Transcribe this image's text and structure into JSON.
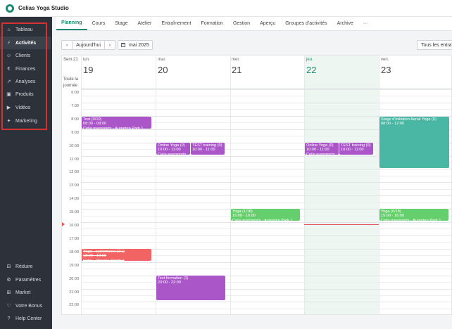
{
  "app": {
    "title": "Celias Yoga Studio"
  },
  "sidebar": {
    "items": [
      {
        "label": "Tableau",
        "icon": "home-icon"
      },
      {
        "label": "Activités",
        "icon": "activity-icon"
      },
      {
        "label": "Clients",
        "icon": "user-icon"
      },
      {
        "label": "Finances",
        "icon": "euro-icon"
      },
      {
        "label": "Analyses",
        "icon": "chart-icon"
      },
      {
        "label": "Produits",
        "icon": "box-icon"
      },
      {
        "label": "Vidéos",
        "icon": "play-icon"
      },
      {
        "label": "Marketing",
        "icon": "megaphone-icon"
      }
    ],
    "bottom": [
      {
        "label": "Réduire",
        "icon": "collapse-icon"
      },
      {
        "label": "Paramètres",
        "icon": "gear-icon"
      },
      {
        "label": "Market",
        "icon": "market-icon"
      },
      {
        "label": "Votre Bonus",
        "icon": "heart-icon"
      },
      {
        "label": "Help Center",
        "icon": "help-icon"
      }
    ],
    "highlight_color": "#d83131"
  },
  "tabs": [
    "Planning",
    "Cours",
    "Stage",
    "Atelier",
    "Entraînement",
    "Formation",
    "Gestion",
    "Aperçu",
    "Groupes d'activités",
    "Archive",
    "···"
  ],
  "toolbar": {
    "prev": "‹",
    "today": "Aujourd'hui",
    "next": "›",
    "month": "mai 2025",
    "filter": "Tous les entraîn"
  },
  "calendar": {
    "week_label": "Sem.21",
    "allday_label": "Toute la journée",
    "days": [
      {
        "name": "lun.",
        "num": "19"
      },
      {
        "name": "mar.",
        "num": "20"
      },
      {
        "name": "mer.",
        "num": "21"
      },
      {
        "name": "jeu.",
        "num": "22"
      },
      {
        "name": "ven.",
        "num": "23"
      }
    ],
    "hours": [
      "6:00",
      "7:00",
      "8:00",
      "9:00",
      "10:00",
      "11:00",
      "12:00",
      "13:00",
      "14:00",
      "15:00",
      "16:00",
      "17:00",
      "18:00",
      "19:00",
      "20:00",
      "21:00",
      "22:00"
    ],
    "events": [
      {
        "lines": [
          "Test (0/10)",
          "08:00 - 09:00",
          "Celia eversports - Augarten Park 1"
        ]
      },
      {
        "lines": [
          "Online Yoga (0)",
          "10:00 - 11:00",
          "Celia eversports"
        ]
      },
      {
        "lines": [
          "TEST training (0)",
          "10:00 - 11:00"
        ]
      },
      {
        "lines": [
          "Online Yoga (0)",
          "10:00 - 11:00",
          "Celia eversports"
        ]
      },
      {
        "lines": [
          "TEST training (0)",
          "10:00 - 11:00"
        ]
      },
      {
        "lines": [
          "Stage d'initiation Aerial Yoga (0)",
          "08:00 - 12:00"
        ]
      },
      {
        "lines": [
          "Yoga (1/18)",
          "15:00 - 16:00",
          "Celia eversports - Augarten Park 1"
        ]
      },
      {
        "lines": [
          "Yoga (0/18)",
          "15:00 - 16:00",
          "Celia eversports - Augarten Park 1"
        ]
      },
      {
        "lines": [
          "Yoga - customized (0/1)",
          "18:00 - 19:00",
          "Celia - Vinyasa Room 1"
        ]
      },
      {
        "lines": [
          "Test formation (1)",
          "20:00 - 22:00"
        ]
      }
    ]
  },
  "colors": {
    "accent": "#1e8a72",
    "event_purple": "#ab56c8",
    "event_green": "#66cf6d",
    "event_teal": "#4ab7a5",
    "event_red": "#f26464",
    "now_line": "#e25555"
  }
}
